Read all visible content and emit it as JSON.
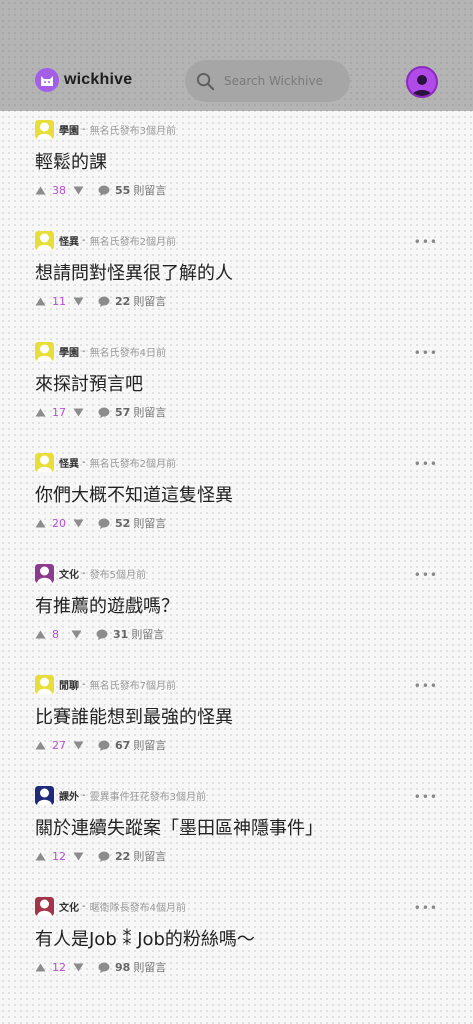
{
  "app": {
    "name": "wickhive",
    "search_placeholder": "Search Wickhive"
  },
  "colors": {
    "accent": "#b04be8",
    "vote_count": "#b84fd6",
    "header_bg": "#b4b4b4",
    "board_yellow": "#e8de3a",
    "board_purple": "#8a3a8f",
    "board_navy": "#1f2a7a",
    "board_crimson": "#a3354a"
  },
  "posts": [
    {
      "board": "學園",
      "author": "無名氏發布",
      "time": "3個月前",
      "title": "輕鬆的課",
      "votes": "38",
      "comments": "55",
      "comments_label": "則留言",
      "icon_color": "#e8de3a",
      "show_more": false
    },
    {
      "board": "怪異",
      "author": "無名氏發布",
      "time": "2個月前",
      "title": "想請問對怪異很了解的人",
      "votes": "11",
      "comments": "22",
      "comments_label": "則留言",
      "icon_color": "#e8de3a",
      "show_more": true
    },
    {
      "board": "學園",
      "author": "無名氏發布",
      "time": "4日前",
      "title": "來探討預言吧",
      "votes": "17",
      "comments": "57",
      "comments_label": "則留言",
      "icon_color": "#e8de3a",
      "show_more": true
    },
    {
      "board": "怪異",
      "author": "無名氏發布",
      "time": "2個月前",
      "title": "你們大概不知道這隻怪異",
      "votes": "20",
      "comments": "52",
      "comments_label": "則留言",
      "icon_color": "#e8de3a",
      "show_more": true
    },
    {
      "board": "文化",
      "author": "發布",
      "time": "5個月前",
      "title": "有推薦的遊戲嗎？",
      "votes": "8",
      "comments": "31",
      "comments_label": "則留言",
      "icon_color": "#8a3a8f",
      "show_more": true
    },
    {
      "board": "閒聊",
      "author": "無名氏發布",
      "time": "7個月前",
      "title": "比賽誰能想到最強的怪異",
      "votes": "27",
      "comments": "67",
      "comments_label": "則留言",
      "icon_color": "#e8de3a",
      "show_more": true
    },
    {
      "board": "課外",
      "author": "靈異事件狂花發布",
      "time": "3個月前",
      "title": "關於連續失蹤案「墨田區神隱事件」",
      "votes": "12",
      "comments": "22",
      "comments_label": "則留言",
      "icon_color": "#1f2a7a",
      "show_more": true
    },
    {
      "board": "文化",
      "author": "暱衛隊長發布",
      "time": "4個月前",
      "title": "有人是Job ⁑ Job的粉絲嗎～",
      "votes": "12",
      "comments": "98",
      "comments_label": "則留言",
      "icon_color": "#a3354a",
      "show_more": true
    }
  ],
  "separator": "-",
  "more_glyph": "•••"
}
